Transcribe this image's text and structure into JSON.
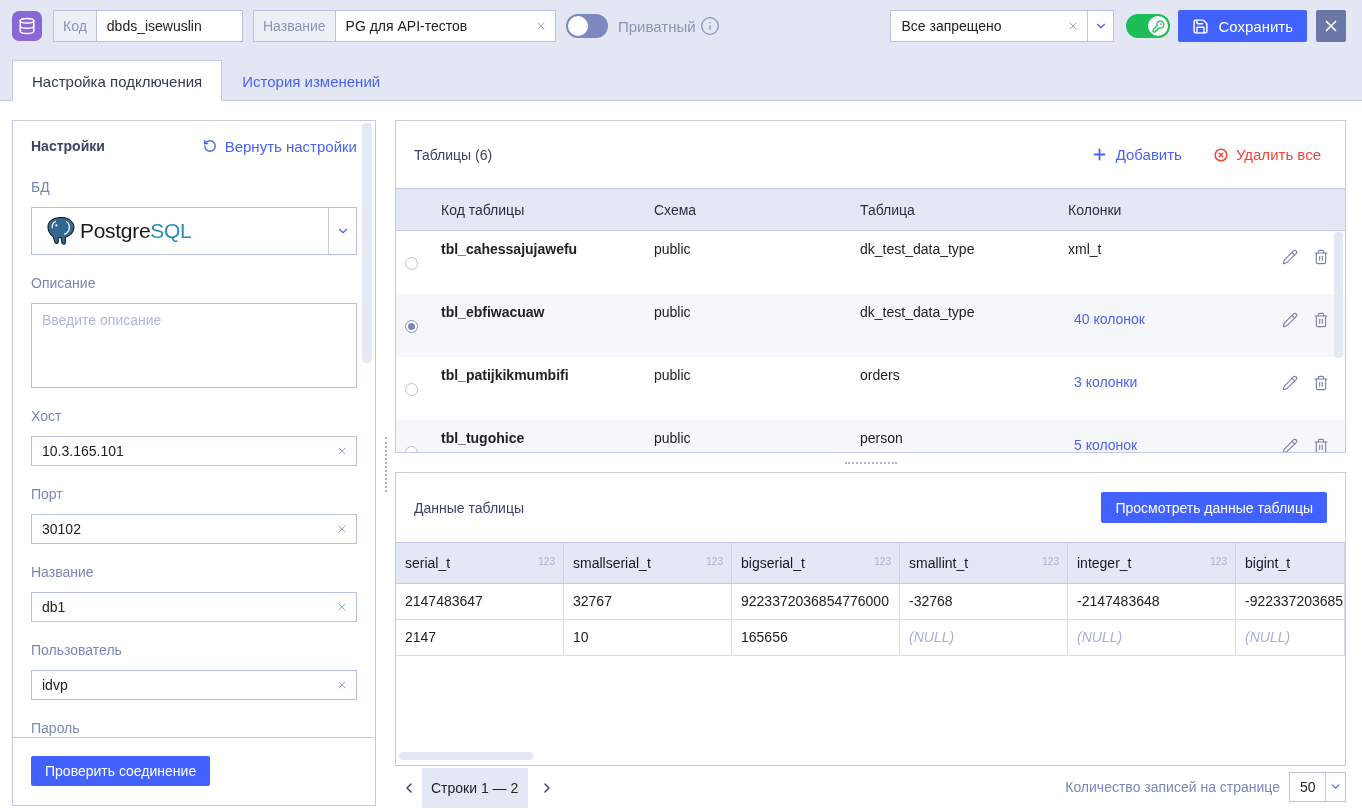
{
  "header": {
    "code_field": {
      "label": "Код",
      "value": "dbds_isewuslin"
    },
    "name_field": {
      "label": "Название",
      "value": "PG для API-тестов"
    },
    "private_toggle": {
      "on": false,
      "label": "Приватный"
    },
    "access_select": {
      "value": "Все запрещено"
    },
    "access_toggle": {
      "on": true
    },
    "save_button": "Сохранить"
  },
  "tabs": [
    {
      "label": "Настройка подключения",
      "selected": true
    },
    {
      "label": "История изменений",
      "selected": false
    }
  ],
  "settings": {
    "title": "Настройки",
    "reset_link": "Вернуть настройки",
    "fields": [
      {
        "kind": "db",
        "label": "БД",
        "logo_text": "Postgre",
        "logo_accent": "SQL"
      },
      {
        "kind": "textarea",
        "label": "Описание",
        "placeholder": "Введите описание"
      },
      {
        "kind": "input",
        "label": "Хост",
        "value": "10.3.165.101"
      },
      {
        "kind": "input",
        "label": "Порт",
        "value": "30102"
      },
      {
        "kind": "input",
        "label": "Название",
        "value": "db1"
      },
      {
        "kind": "input",
        "label": "Пользователь",
        "value": "idvp"
      },
      {
        "kind": "label",
        "label": "Пароль"
      }
    ],
    "check_button": "Проверить соединение"
  },
  "tables_panel": {
    "title": "Таблицы (6)",
    "add_button": "Добавить",
    "delete_all_button": "Удалить все",
    "columns": [
      "Код таблицы",
      "Схема",
      "Таблица",
      "Колонки"
    ],
    "rows": [
      {
        "code": "tbl_cahessajujawefu",
        "schema": "public",
        "table": "dk_test_data_type",
        "columns": {
          "kind": "text",
          "text": "xml_t"
        },
        "selected": false
      },
      {
        "code": "tbl_ebfiwacuaw",
        "schema": "public",
        "table": "dk_test_data_type",
        "columns": {
          "kind": "link",
          "text": "40 колонок"
        },
        "selected": true
      },
      {
        "code": "tbl_patijkikmumbifi",
        "schema": "public",
        "table": "orders",
        "columns": {
          "kind": "link",
          "text": "3 колонки"
        },
        "selected": false
      },
      {
        "code": "tbl_tugohice",
        "schema": "public",
        "table": "person",
        "columns": {
          "kind": "link",
          "text": "5 колонок"
        },
        "selected": false
      }
    ]
  },
  "data_panel": {
    "title": "Данные таблицы",
    "view_button": "Просмотреть данные таблицы",
    "columns": [
      {
        "name": "serial_t",
        "type": "123"
      },
      {
        "name": "smallserial_t",
        "type": "123"
      },
      {
        "name": "bigserial_t",
        "type": "123"
      },
      {
        "name": "smallint_t",
        "type": "123"
      },
      {
        "name": "integer_t",
        "type": "123"
      },
      {
        "name": "bigint_t"
      }
    ],
    "rows": [
      [
        {
          "text": "2147483647",
          "null": false
        },
        {
          "text": "32767",
          "null": false
        },
        {
          "text": "9223372036854776000",
          "null": false
        },
        {
          "text": "-32768",
          "null": false
        },
        {
          "text": "-2147483648",
          "null": false
        },
        {
          "text": "-922337203685",
          "null": false
        }
      ],
      [
        {
          "text": "2147",
          "null": false
        },
        {
          "text": "10",
          "null": false
        },
        {
          "text": "165656",
          "null": false
        },
        {
          "text": "(NULL)",
          "null": true
        },
        {
          "text": "(NULL)",
          "null": true
        },
        {
          "text": "(NULL)",
          "null": true
        }
      ]
    ]
  },
  "pagination": {
    "range": "Строки 1 — 2",
    "page_size_label": "Количество записей на странице",
    "page_size": "50"
  }
}
